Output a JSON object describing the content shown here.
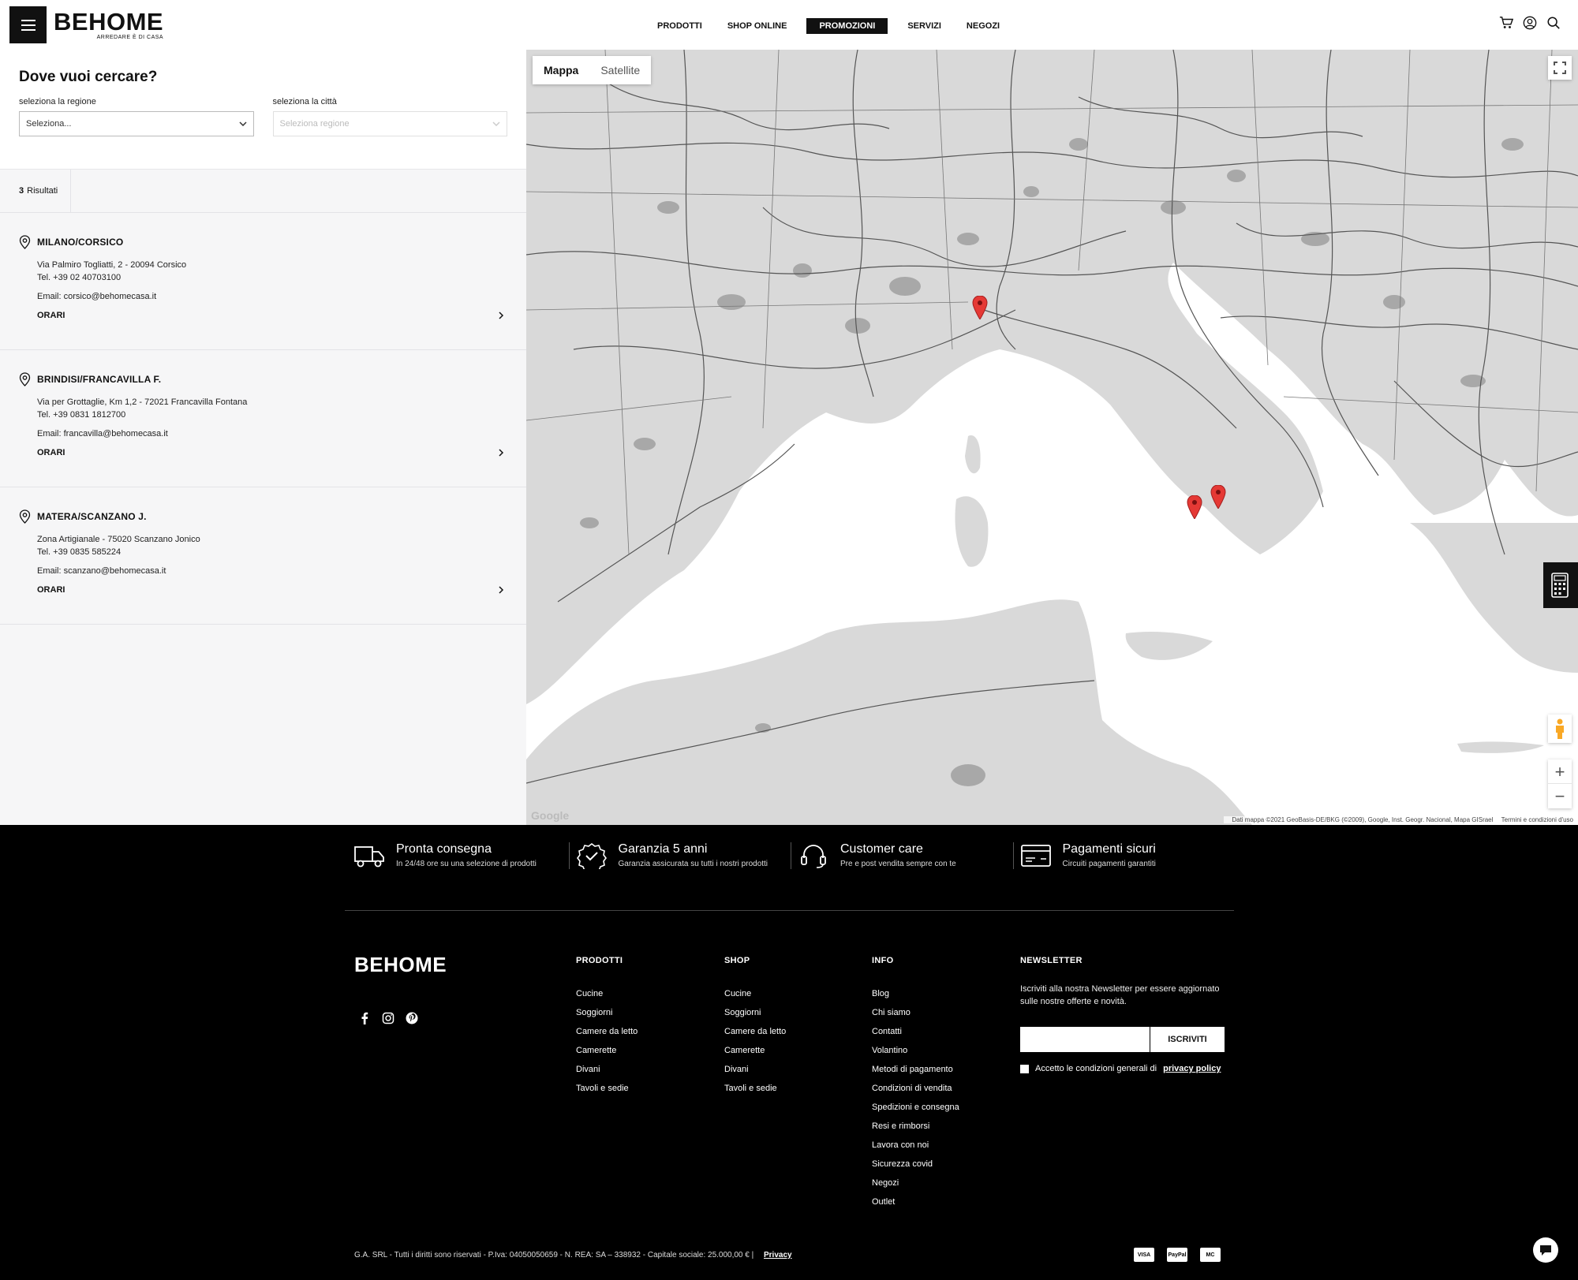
{
  "header": {
    "logo_text": "BEHOME",
    "logo_tagline": "ARREDARE È DI CASA",
    "nav": [
      {
        "label": "PRODOTTI"
      },
      {
        "label": "SHOP ONLINE"
      },
      {
        "label": "PROMOZIONI",
        "active": true
      },
      {
        "label": "SERVIZI"
      },
      {
        "label": "NEGOZI"
      }
    ],
    "icons": [
      "cart-icon",
      "user-icon",
      "search-icon"
    ]
  },
  "search": {
    "title": "Dove vuoi cercare?",
    "region_label": "seleziona la regione",
    "region_value": "Seleziona...",
    "city_label": "seleziona la città",
    "city_value": "Seleziona regione"
  },
  "results": {
    "count": "3",
    "label": "Risultati"
  },
  "stores": [
    {
      "name": "MILANO/CORSICO",
      "address": "Via Palmiro Togliatti, 2 - 20094 Corsico",
      "phone": "Tel. +39 02 40703100",
      "email": "Email: corsico@behomecasa.it",
      "hours_label": "ORARI"
    },
    {
      "name": "BRINDISI/FRANCAVILLA F.",
      "address": "Via per Grottaglie, Km 1,2 - 72021 Francavilla Fontana",
      "phone": "Tel. +39 0831 1812700",
      "email": "Email: francavilla@behomecasa.it",
      "hours_label": "ORARI"
    },
    {
      "name": "MATERA/SCANZANO J.",
      "address": "Zona Artigianale - 75020 Scanzano Jonico",
      "phone": "Tel. +39 0835 585224",
      "email": "Email: scanzano@behomecasa.it",
      "hours_label": "ORARI"
    }
  ],
  "map": {
    "type_map": "Mappa",
    "type_satellite": "Satellite",
    "google": "Google",
    "attribution": "Dati mappa ©2021 GeoBasis-DE/BKG (©2009), Google, Inst. Geogr. Nacional, Mapa GISrael",
    "terms": "Termini e condizioni d'uso",
    "zoom_in": "+",
    "zoom_out": "−",
    "markers": [
      "Milano/Corsico",
      "Matera/Scanzano J.",
      "Brindisi/Francavilla F."
    ]
  },
  "features": [
    {
      "title": "Pronta consegna",
      "subtitle": "In 24/48 ore su una selezione di prodotti",
      "icon": "truck-icon"
    },
    {
      "title": "Garanzia 5 anni",
      "subtitle": "Garanzia assicurata su tutti i nostri prodotti",
      "icon": "badge-check-icon"
    },
    {
      "title": "Customer care",
      "subtitle": "Pre e post vendita sempre con te",
      "icon": "headset-icon"
    },
    {
      "title": "Pagamenti sicuri",
      "subtitle": "Circuiti pagamenti garantiti",
      "icon": "credit-card-icon"
    }
  ],
  "footer": {
    "logo": "BEHOME",
    "columns": [
      {
        "title": "PRODOTTI",
        "links": [
          "Cucine",
          "Soggiorni",
          "Camere da letto",
          "Camerette",
          "Divani",
          "Tavoli e sedie"
        ]
      },
      {
        "title": "SHOP",
        "links": [
          "Cucine",
          "Soggiorni",
          "Camere da letto",
          "Camerette",
          "Divani",
          "Tavoli e sedie"
        ]
      },
      {
        "title": "INFO",
        "links": [
          "Blog",
          "Chi siamo",
          "Contatti",
          "Volantino",
          "Metodi di pagamento",
          "Condizioni di vendita",
          "Spedizioni e consegna",
          "Resi e rimborsi",
          "Lavora con noi",
          "Sicurezza covid",
          "Negozi",
          "Outlet"
        ]
      }
    ],
    "newsletter": {
      "title": "NEWSLETTER",
      "text": "Iscriviti alla nostra Newsletter per essere aggiornato sulle nostre offerte e novità.",
      "button": "ISCRIVITI",
      "consent": "Accetto le condizioni generali di",
      "consent_link": "privacy policy"
    },
    "legal": "G.A. SRL - Tutti i diritti sono riservati - P.Iva: 04050050659 - N. REA: SA – 338932 - Capitale sociale: 25.000,00 €  |",
    "privacy": "Privacy",
    "payments": [
      "VISA",
      "PayPal",
      "MC"
    ]
  }
}
